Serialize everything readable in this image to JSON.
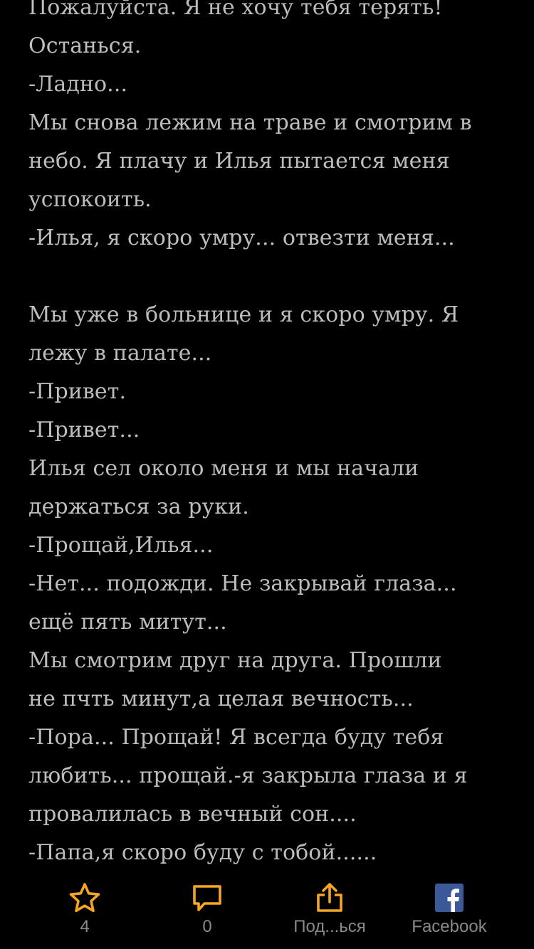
{
  "story": {
    "lines": [
      "Пожалуйста. Я не хочу тебя терять!",
      "Останься.",
      "-Ладно...",
      "Мы снова лежим на траве и смотрим в",
      "небо. Я плачу и Илья пытается меня",
      "успокоить.",
      "-Илья, я скоро умру... отвезти меня...",
      "",
      "Мы уже в больнице и я скоро умру. Я",
      "лежу в палате...",
      "-Привет.",
      "-Привет...",
      "Илья сел около меня и мы начали",
      "держаться за руки.",
      "-Прощай,Илья...",
      "-Нет... подожди. Не закрывай глаза...",
      "ещё пять митут...",
      "Мы смотрим друг на друга. Прошли",
      "не пчть минут,а целая вечность...",
      "-Пора... Прощай! Я всегда буду тебя",
      "любить... прощай.-я закрыла глаза и я",
      "провалилась в вечный сон....",
      "-Папа,я скоро буду с тобой......"
    ]
  },
  "toolbar": {
    "rating": {
      "icon": "star-icon",
      "count": "4"
    },
    "comments": {
      "icon": "comment-icon",
      "count": "0"
    },
    "share": {
      "icon": "share-icon",
      "label": "Под...ься"
    },
    "facebook": {
      "icon": "facebook-icon",
      "label": "Facebook"
    }
  },
  "colors": {
    "background": "#000000",
    "text": "#bdbdbd",
    "accent": "#f5a623",
    "facebook": "#3b5998",
    "label": "#8a8a8a"
  }
}
